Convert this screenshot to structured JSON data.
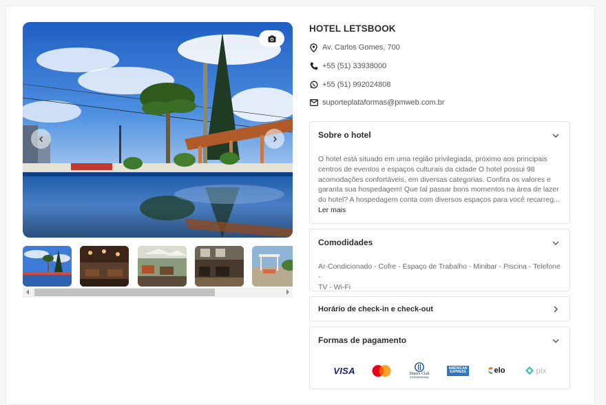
{
  "hotel": {
    "name": "HOTEL LETSBOOK",
    "address": "Av. Carlos Gomes, 700",
    "phone": "+55 (51) 33938000",
    "whatsapp": "+55 (51) 992024808",
    "email": "suporteplataformas@pmweb.com.br"
  },
  "gallery": {
    "camera_icon": "camera-icon",
    "prev_icon": "chevron-left-icon",
    "next_icon": "chevron-right-icon",
    "thumbnail_count": 5
  },
  "sections": {
    "about": {
      "title": "Sobre o hotel",
      "lines": [
        "O hotel está situado em uma região privilegiada, próximo aos principais",
        "centros de eventos e espaços culturais da cidade O hotel possui 98",
        "acomodações confortáveis, em diversas categorias. Confira os valores e",
        "garanta sua hospedagem! Que tal passar bons momentos na área de lazer",
        "do hotel? A hospedagem conta com diversos espaços para você recarreg..."
      ],
      "read_more": "Ler mais"
    },
    "amenities": {
      "title": "Comodidades",
      "lines": [
        "Ar-Condicionado - Cofre - Espaço de Trabalho - Minibar - Piscina - Telefone -",
        "TV - Wi-Fi"
      ]
    },
    "checkin": {
      "title": "Horário de check-in e check-out"
    },
    "payment": {
      "title": "Formas de pagamento",
      "visa": "VISA",
      "diners": "Diners Club",
      "diners_sub": "INTERNATIONAL",
      "amex_1": "AMERICAN",
      "amex_2": "EXPRESS",
      "elo": "elo",
      "pix": "pix"
    }
  },
  "colors": {
    "accent_text": "#2d2d2d",
    "visa_blue": "#1a1f71",
    "mastercard_red": "#eb001b",
    "mastercard_orange": "#f79e1b",
    "amex_blue": "#2e77bc",
    "pix_teal": "#32bcad"
  }
}
